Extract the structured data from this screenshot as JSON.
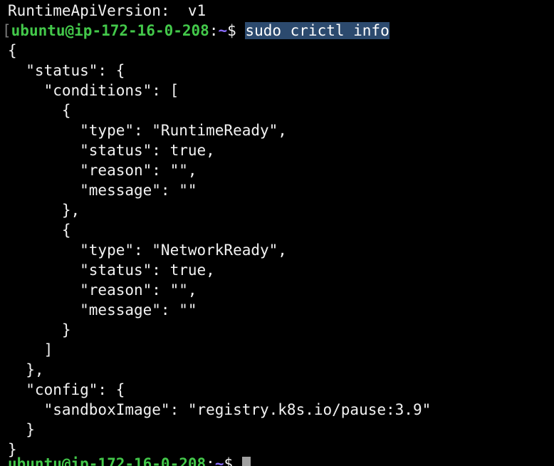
{
  "terminal": {
    "first_line": "RuntimeApiVersion:  v1",
    "prompt": {
      "bracket": "[",
      "user_host": "ubuntu@ip-172-16-0-208",
      "colon": ":",
      "path": "~",
      "symbol": "$ ",
      "command": "sudo crictl info"
    },
    "output_lines": [
      "{",
      "  \"status\": {",
      "    \"conditions\": [",
      "      {",
      "        \"type\": \"RuntimeReady\",",
      "        \"status\": true,",
      "        \"reason\": \"\",",
      "        \"message\": \"\"",
      "      },",
      "      {",
      "        \"type\": \"NetworkReady\",",
      "        \"status\": true,",
      "        \"reason\": \"\",",
      "        \"message\": \"\"",
      "      }",
      "    ]",
      "  },",
      "  \"config\": {",
      "    \"sandboxImage\": \"registry.k8s.io/pause:3.9\"",
      "  }",
      "}"
    ],
    "last_prompt": {
      "user_host": "ubuntu@ip-172-16-0-208",
      "colon": ":",
      "path": "~",
      "symbol": "$ "
    }
  },
  "colors": {
    "background": "#000000",
    "text": "#f2f2f2",
    "user_host": "#43c84a",
    "path": "#8a6cff",
    "selection": "#2c4a6e",
    "cursor": "#a0a0a0"
  }
}
